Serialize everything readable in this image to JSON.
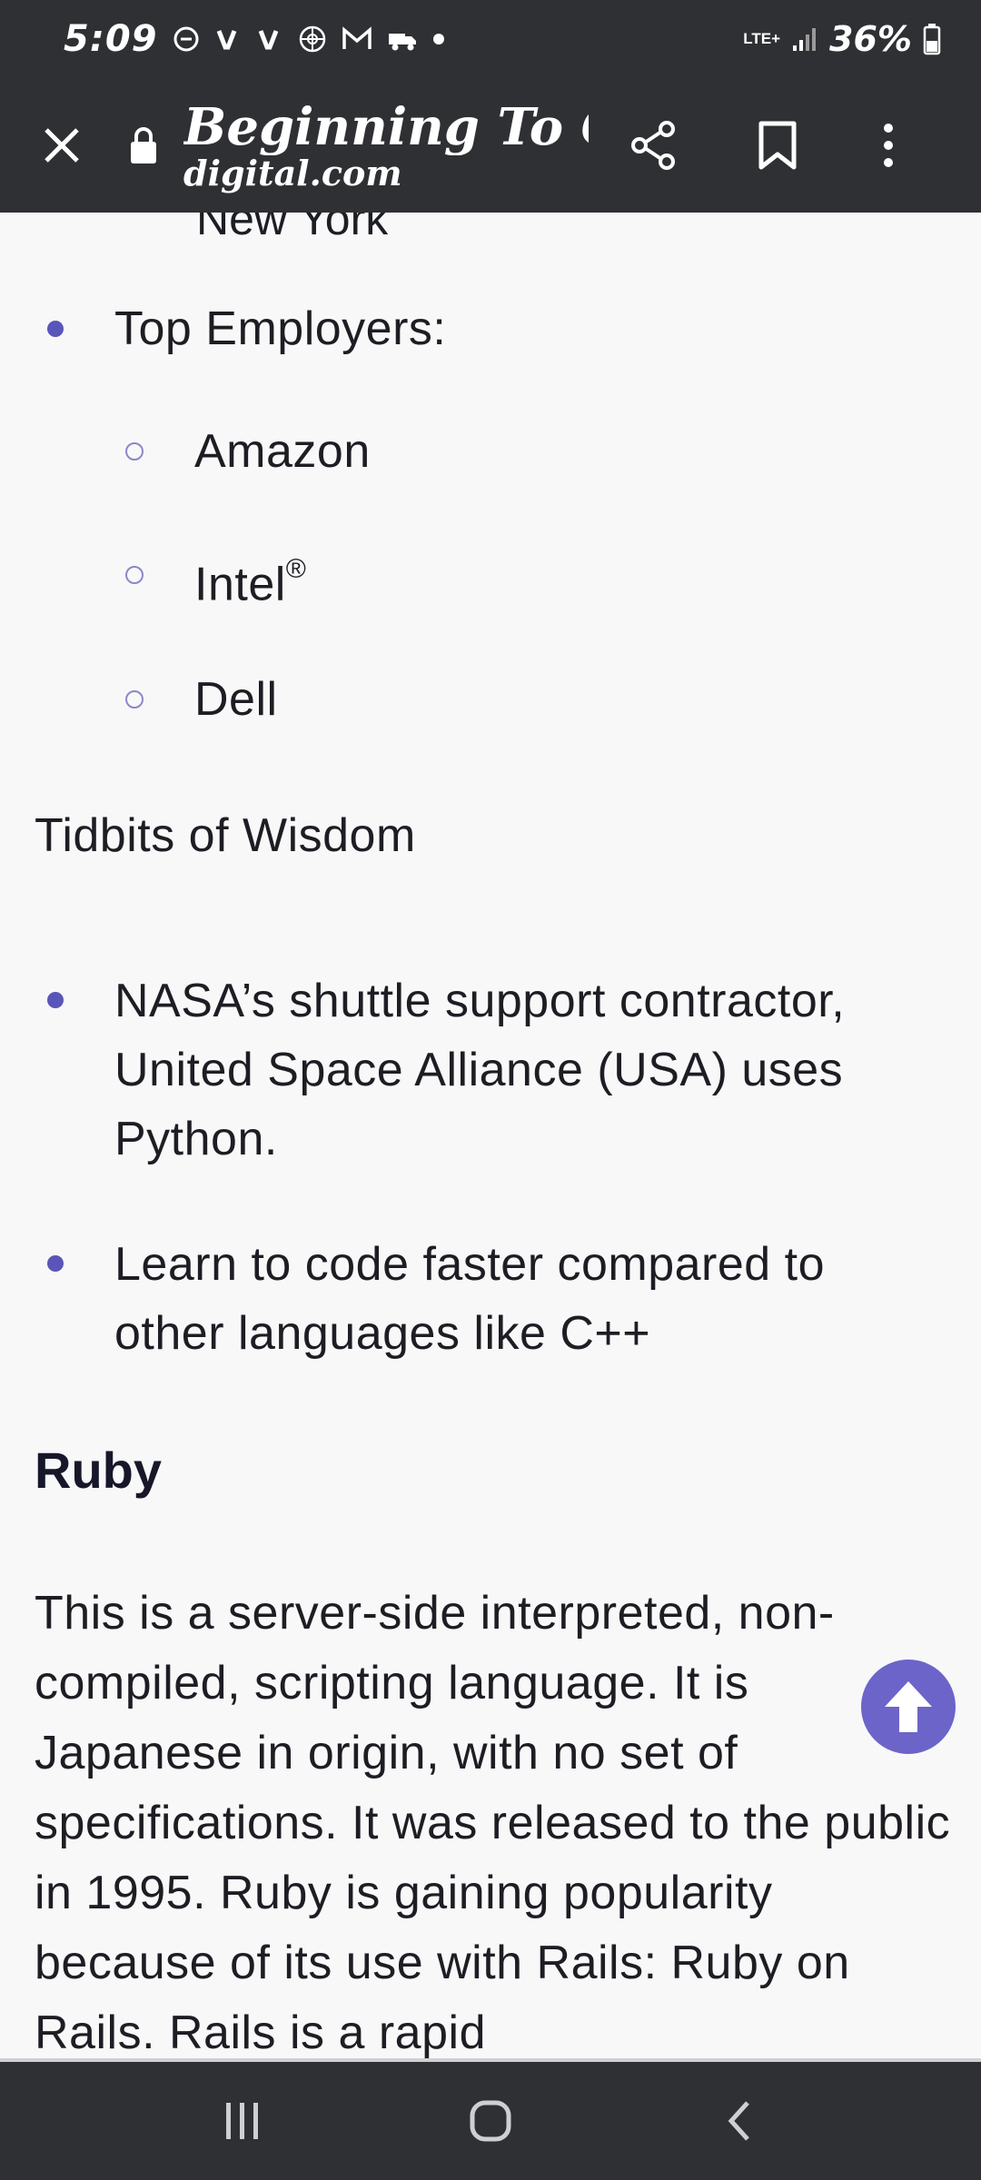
{
  "status_bar": {
    "time": "5:09",
    "network": "LTE+",
    "battery": "36%"
  },
  "toolbar": {
    "title": "Beginning To Co...",
    "domain": "digital.com"
  },
  "content": {
    "partial_line": "New York",
    "employers_label": "Top Employers:",
    "employers": [
      "Amazon",
      "Intel",
      "Dell"
    ],
    "intel_mark": "®",
    "wisdom_title": "Tidbits of Wisdom",
    "wisdom_items": [
      "NASA’s shuttle support contractor, United Space Alliance (USA) uses Python.",
      "Learn to code faster compared to other languages like C++"
    ],
    "ruby_heading": "Ruby",
    "ruby_paragraph": "This is a server-side interpreted, non-compiled, scripting language. It is Japanese in origin, with no set of specifications. It was released to the public in 1995. Ruby is gaining popularity because of its use with Rails: Ruby on Rails. Rails is a rapid"
  },
  "colors": {
    "chrome": "#2f3033",
    "accent": "#6c64c9",
    "bullet": "#5a55b8",
    "background": "#f8f8f9"
  }
}
